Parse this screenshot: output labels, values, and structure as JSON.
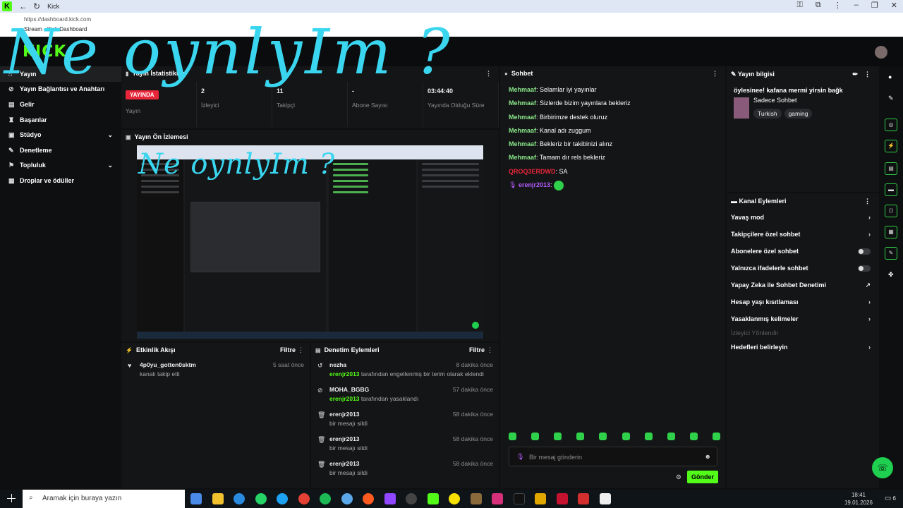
{
  "browser": {
    "tab_title": "Kick",
    "url": "https://dashboard.kick.com",
    "page_title": "Stream - Kick Dashboard",
    "logo_letter": "K"
  },
  "overlay_text": "Ne oynlyIm ?",
  "brand": "KICK",
  "sidebar": {
    "items": [
      {
        "label": "Yayın",
        "icon": "home-icon"
      },
      {
        "label": "Yayın Bağlantısı ve Anahtarı",
        "icon": "link-icon"
      },
      {
        "label": "Gelir",
        "icon": "money-icon"
      },
      {
        "label": "Başarılar",
        "icon": "trophy-icon"
      },
      {
        "label": "Stüdyo",
        "icon": "studio-icon"
      },
      {
        "label": "Denetleme",
        "icon": "wrench-icon"
      },
      {
        "label": "Topluluk",
        "icon": "community-icon"
      },
      {
        "label": "Droplar ve ödüller",
        "icon": "gift-icon"
      }
    ]
  },
  "stats_panel": {
    "title": "Yayın İstatistikleri",
    "live_label": "YAYINDA",
    "stats": [
      {
        "value": "",
        "label": "Yayın"
      },
      {
        "value": "2",
        "label": "İzleyici"
      },
      {
        "value": "11",
        "label": "Takipçi"
      },
      {
        "value": "-",
        "label": "Abone Sayısı"
      },
      {
        "value": "03:44:40",
        "label": "Yayında Olduğu Süre"
      }
    ]
  },
  "preview": {
    "title": "Yayın Ön İzlemesi"
  },
  "activity": {
    "title": "Etkinlik Akışı",
    "filter": "Filtre",
    "items": [
      {
        "user": "4p0yu_gotten0sktm",
        "desc": "kanalı takip etti",
        "time": "5 saat önce"
      }
    ]
  },
  "moderation": {
    "title": "Denetim Eylemleri",
    "filter": "Filtre",
    "items": [
      {
        "user": "nezha",
        "actor": "erenjr2013",
        "desc": "tarafından engellenmiş bir terim olarak eklendi",
        "time": "8 dakika önce"
      },
      {
        "user": "MOHA_BGBG",
        "actor": "erenjr2013",
        "desc": "tarafından yasaklandı",
        "time": "57 dakika önce"
      },
      {
        "user": "erenjr2013",
        "actor": "",
        "desc": "bir mesajı sildi",
        "time": "58 dakika önce"
      },
      {
        "user": "erenjr2013",
        "actor": "",
        "desc": "bir mesajı sildi",
        "time": "58 dakika önce"
      },
      {
        "user": "erenjr2013",
        "actor": "",
        "desc": "bir mesajı sildi",
        "time": "58 dakika önce"
      }
    ]
  },
  "chat": {
    "title": "Sohbet",
    "messages": [
      {
        "user": "Mehmaaf",
        "text": "Selamlar iyi yayınlar"
      },
      {
        "user": "Mehmaaf",
        "text": "Sizlerde bizim yayınlara bekleriz"
      },
      {
        "user": "Mehmaaf",
        "text": "Birbirimze destek oluruz"
      },
      {
        "user": "Mehmaaf",
        "text": "Kanal adı zuggum"
      },
      {
        "user": "Mehmaaf",
        "text": "Bekleriz bir takibinizi alınz"
      },
      {
        "user": "Mehmaaf",
        "text": "Tamam dır rels bekleriz"
      },
      {
        "user": "QROQ3ERDWD",
        "text": "SA"
      },
      {
        "user": "erenjr2013",
        "text": ""
      }
    ],
    "input_placeholder": "Bir mesaj gönderin",
    "send_label": "Gönder"
  },
  "stream_info": {
    "title": "Yayın bilgisi",
    "stream_title": "öylesinee! kafana mermi yirsin bağk",
    "category": "Sadece Sohbet",
    "tags": [
      "Turkish",
      "gaming"
    ]
  },
  "channel_actions": {
    "title": "Kanal Eylemleri",
    "items": [
      {
        "label": "Yavaş mod",
        "kind": "chevron"
      },
      {
        "label": "Takipçilere özel sohbet",
        "kind": "chevron"
      },
      {
        "label": "Abonelere özel sohbet",
        "kind": "toggle"
      },
      {
        "label": "Yalnızca ifadelerle sohbet",
        "kind": "toggle"
      },
      {
        "label": "Yapay Zeka ile Sohbet Denetimi",
        "kind": "external"
      },
      {
        "label": "Hesap yaşı kısıtlaması",
        "kind": "chevron"
      },
      {
        "label": "Yasaklanmış kelimeler",
        "kind": "chevron"
      },
      {
        "label": "İzleyici Yönlendir",
        "kind": "muted"
      },
      {
        "label": "Hedefleri belirleyin",
        "kind": "chevron"
      }
    ]
  },
  "taskbar": {
    "search_placeholder": "Aramak için buraya yazın",
    "time": "18:41",
    "date": "19.01.2026",
    "notification_count": "6"
  },
  "colors": {
    "accent": "#53fc18",
    "live": "#e8263a",
    "overlay": "#3ad6f0"
  }
}
